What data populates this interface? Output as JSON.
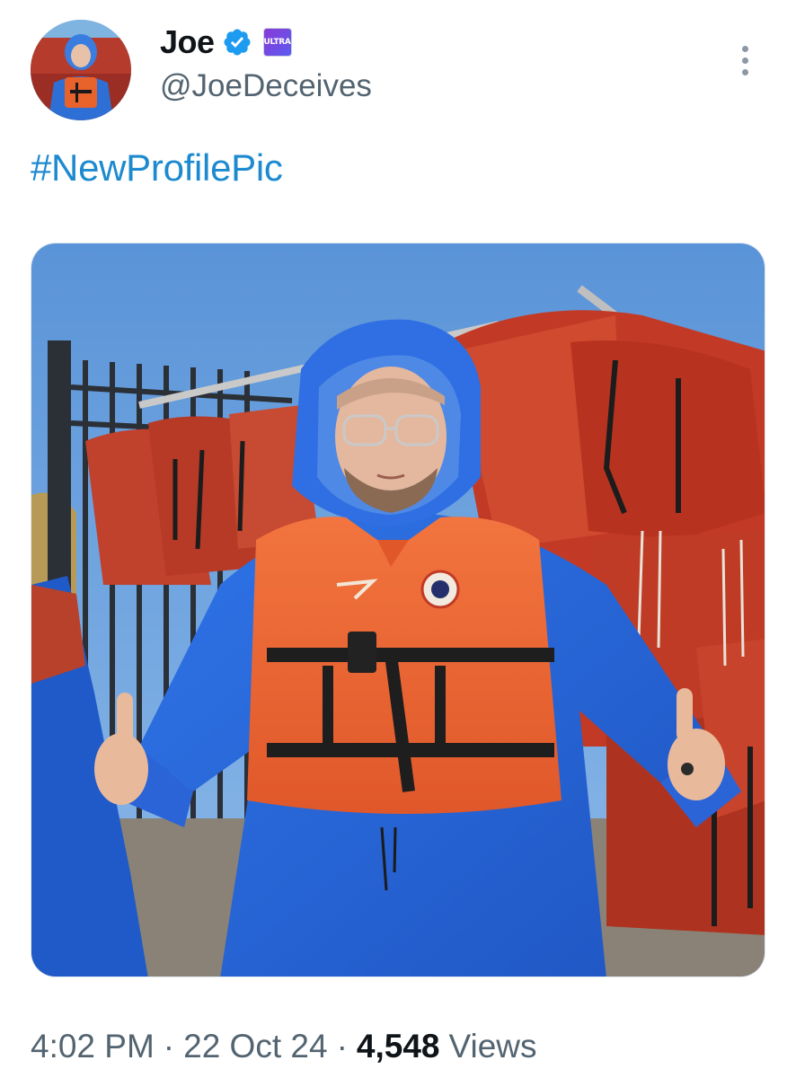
{
  "tweet": {
    "author": {
      "display_name": "Joe",
      "handle": "@JoeDeceives",
      "verified_icon": "verified-badge-icon",
      "affiliate_badge_text": "ULTRA"
    },
    "text": "#NewProfilePic",
    "media": {
      "type": "photo",
      "description_icon": "profile-photo"
    },
    "meta": {
      "time": "4:02 PM",
      "separator": "·",
      "date": "22 Oct 24",
      "views_count": "4,548",
      "views_label": "Views"
    },
    "more_icon": "more-options-icon"
  },
  "colors": {
    "link": "#1d9bf0",
    "verified": "#1d9bf0",
    "secondary_text": "#536471",
    "primary_text": "#0f1419"
  }
}
